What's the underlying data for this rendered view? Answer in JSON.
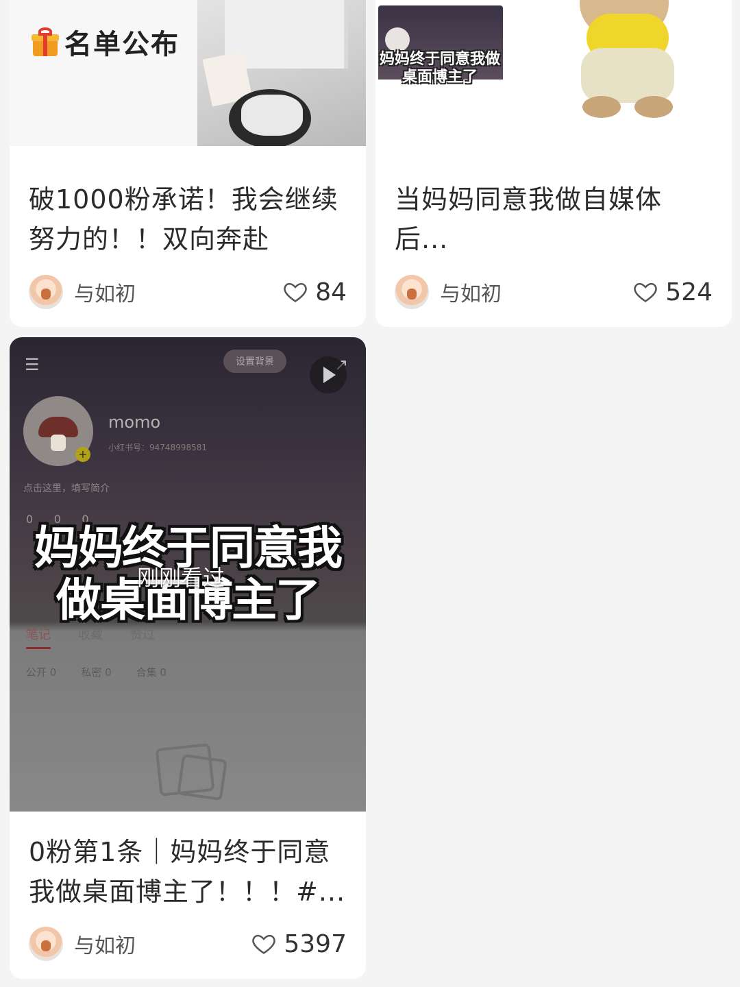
{
  "feed": {
    "cards": [
      {
        "cover_text": "名单公布",
        "title": "破1000粉承诺！我会继续努力的！！双向奔赴",
        "author": "与如初",
        "likes": "84"
      },
      {
        "cover_caption": "妈妈终于同意我做桌面博主了",
        "title": "当妈妈同意我做自媒体后...",
        "author": "与如初",
        "likes": "524"
      },
      {
        "cover": {
          "profile_name": "momo",
          "profile_id": "小红书号：94748998581",
          "bio": "点击这里，填写简介",
          "stats": "0      0      0",
          "caption": "妈妈终于同意我做桌面博主了",
          "viewed_label": "刚刚看过",
          "tabs": [
            "笔记",
            "收藏",
            "赞过"
          ],
          "subtabs": [
            "公开 0",
            "私密 0",
            "合集 0"
          ],
          "bg_pill": "设置背景"
        },
        "title": "0粉第1条｜妈妈终于同意我做桌面博主了！！！#...",
        "author": "与如初",
        "likes": "5397"
      }
    ]
  },
  "icons": [
    "gift-icon",
    "heart-icon",
    "play-icon",
    "menu-icon",
    "share-icon"
  ]
}
